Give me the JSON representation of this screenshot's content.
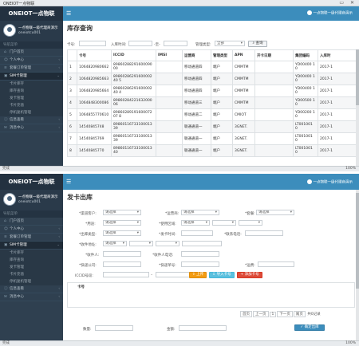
{
  "w1": {
    "window_title": "ONEIOT一点物联",
    "brand": "ONEIOT一点物联",
    "profile": {
      "name": "一点物联一级代理商演示",
      "id": "oneiotcu001"
    },
    "nav_header": "导航菜单",
    "nav": [
      {
        "label": "门户首页"
      },
      {
        "label": "个人中心"
      },
      {
        "label": "套餐订单管理"
      },
      {
        "label": "SIM卡管理"
      }
    ],
    "nav_sub": [
      "卡片库存",
      "库存查询",
      "发卡管理",
      "卡片充值",
      "停机复机管理"
    ],
    "nav_more": [
      {
        "label": "信息查看"
      },
      {
        "label": "消息中心"
      }
    ],
    "topbar_user": "一点物联一级代理商演示",
    "page_title": "库存查询",
    "filters": {
      "card_label": "卡号:",
      "intime_label": "入库时间:",
      "to_label": "-至-",
      "mgmt_label": "管理类型:",
      "mgmt_value": "全部",
      "search_label": "查询"
    },
    "table": {
      "headers": [
        "",
        "卡号",
        "ICCID",
        "IMSI",
        "运营商",
        "管理类型",
        "APN",
        "开卡日期",
        "集团编码",
        "入库时"
      ],
      "rows": [
        [
          "1",
          "1064820980662",
          "8986028829160009000",
          "",
          "移动通道四",
          "端户",
          "CMMTM",
          "",
          "YD00400 10",
          "2017-1"
        ],
        [
          "2",
          "1064820985663",
          "8986028629160000240 5",
          "",
          "移动通道四",
          "端户",
          "CMMTM",
          "",
          "YD00400 10",
          "2017-1"
        ],
        [
          "3",
          "1064820985664",
          "8986028629160000240 4",
          "",
          "移动通道四",
          "端户",
          "CMMTM",
          "",
          "YD00400 10",
          "2017-1"
        ],
        [
          "4",
          "1064848300086",
          "8986028422163200006",
          "",
          "移动通道三",
          "端户",
          "CMMTM",
          "",
          "YD00500 10",
          "2017-1"
        ],
        [
          "5",
          "1064855770610",
          "8986028919160007207 8",
          "",
          "移动通道二",
          "端户",
          "CMIOT",
          "",
          "YD00200 10",
          "2017-1"
        ],
        [
          "6",
          "14540845748",
          "8986011673310001339",
          "",
          "联通通道一",
          "端户",
          "3GNET.",
          "",
          "LT001001 0",
          "2017-1"
        ],
        [
          "7",
          "14540845769",
          "8986011673310001339",
          "",
          "联通通道一",
          "端户",
          "3GNET.",
          "",
          "LT001001 0",
          "2017-1"
        ],
        [
          "8",
          "14540845770",
          "8986011673310001340",
          "",
          "联通通道一",
          "端户",
          "3GNET.",
          "",
          "LT001001 0",
          "2017-1"
        ]
      ]
    },
    "status_left": "完成",
    "status_right": "100%"
  },
  "w2": {
    "brand": "ONEIOT一点物联",
    "profile": {
      "name": "一点物联一级代理商演示",
      "id": "oneiotcu001"
    },
    "nav_header": "导航菜单",
    "nav": [
      {
        "label": "门户首页"
      },
      {
        "label": "个人中心"
      },
      {
        "label": "套餐订单管理"
      },
      {
        "label": "SIM卡管理"
      }
    ],
    "nav_sub": [
      "卡片库存",
      "库存查询",
      "发卡管理",
      "卡片充值",
      "停机复机管理"
    ],
    "nav_more": [
      {
        "label": "信息查看"
      },
      {
        "label": "消息中心"
      }
    ],
    "topbar_user": "一点物联一级代理商演示",
    "page_title": "发卡出库",
    "form": {
      "row1": [
        {
          "label": "*渠道客户:",
          "value": "请选择"
        },
        {
          "label": "*运营商:",
          "value": "请选择"
        },
        {
          "label": "*套餐:",
          "value": "请选择"
        }
      ],
      "row2": [
        {
          "label": "*用途:",
          "value": "请选择"
        },
        {
          "label": "*使用区域:",
          "value": "请选择"
        }
      ],
      "row3": [
        {
          "label": "*出库类型:",
          "value": "请选择"
        },
        {
          "label": "*发卡时间:",
          "value": ""
        },
        {
          "label": "*联系电话:",
          "value": ""
        }
      ],
      "row4": [
        {
          "label": "*收件地址:",
          "value": "请选择"
        }
      ],
      "row5": [
        {
          "label": "*收件人:",
          "value": ""
        },
        {
          "label": "*收件人电话:",
          "value": ""
        }
      ],
      "row6": [
        {
          "label": "*快递公司:",
          "value": ""
        },
        {
          "label": "*快递单号:",
          "value": ""
        },
        {
          "label": "*运费:",
          "value": ""
        }
      ],
      "iccid_label": "ICCID号段:",
      "btn_upload": "上传",
      "btn_import": "导入卡号",
      "btn_add": "添加卡号"
    },
    "table_header": "卡号",
    "pager": {
      "first": "首页",
      "prev": "上一页",
      "page": "1",
      "next": "下一页",
      "last": "尾页",
      "total": "共0记录"
    },
    "qty_label": "数量:",
    "amount_label": "金额:",
    "submit_label": "确定出库",
    "status_left": "完成",
    "status_right": "100%"
  }
}
